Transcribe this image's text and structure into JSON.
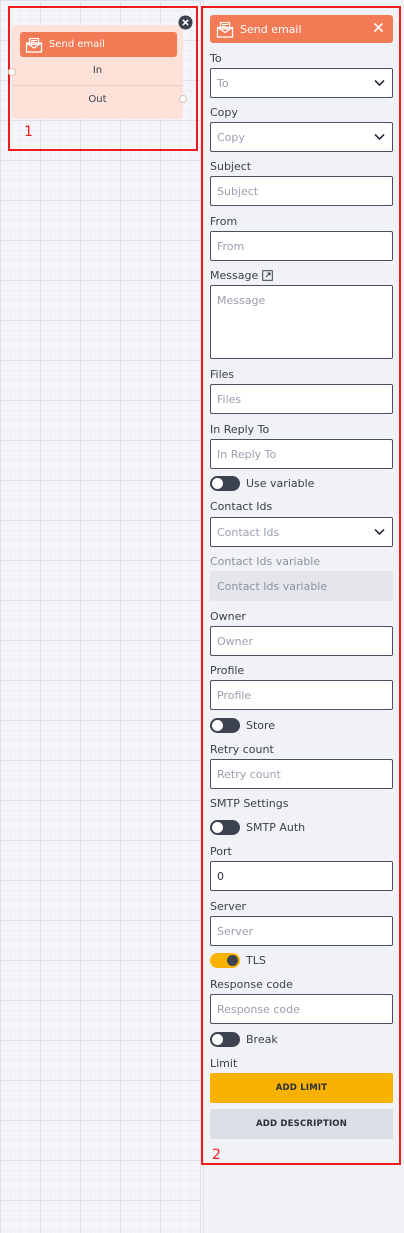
{
  "node": {
    "title": "Send email",
    "in_label": "In",
    "out_label": "Out",
    "region_label": "1"
  },
  "panel": {
    "title": "Send email",
    "region_label": "2",
    "to": {
      "label": "To",
      "placeholder": "To"
    },
    "copy": {
      "label": "Copy",
      "placeholder": "Copy"
    },
    "subject": {
      "label": "Subject",
      "placeholder": "Subject"
    },
    "from": {
      "label": "From",
      "placeholder": "From"
    },
    "message": {
      "label": "Message",
      "placeholder": "Message"
    },
    "files": {
      "label": "Files",
      "placeholder": "Files"
    },
    "in_reply_to": {
      "label": "In Reply To",
      "placeholder": "In Reply To"
    },
    "use_variable": {
      "label": "Use variable",
      "on": false
    },
    "contact_ids": {
      "label": "Contact Ids",
      "placeholder": "Contact Ids"
    },
    "contact_ids_variable": {
      "label": "Contact Ids variable",
      "placeholder": "Contact Ids variable"
    },
    "owner": {
      "label": "Owner",
      "placeholder": "Owner"
    },
    "profile": {
      "label": "Profile",
      "placeholder": "Profile"
    },
    "store": {
      "label": "Store",
      "on": false
    },
    "retry_count": {
      "label": "Retry count",
      "placeholder": "Retry count"
    },
    "smtp_settings_label": "SMTP Settings",
    "smtp_auth": {
      "label": "SMTP Auth",
      "on": false
    },
    "port": {
      "label": "Port",
      "value": "0"
    },
    "server": {
      "label": "Server",
      "placeholder": "Server"
    },
    "tls": {
      "label": "TLS",
      "on": true
    },
    "response_code": {
      "label": "Response code",
      "placeholder": "Response code"
    },
    "break": {
      "label": "Break",
      "on": false
    },
    "limit_label": "Limit",
    "add_limit_button": "ADD LIMIT",
    "add_description_button": "ADD DESCRIPTION"
  },
  "colors": {
    "accent": "#f27a55",
    "node_body": "#fde2da",
    "toggle_on": "#f9b100",
    "annotation_red": "#ee1c1c"
  },
  "icons": {
    "node_icon": "email-icon",
    "close_node": "close-circle-icon",
    "close_panel": "close-icon",
    "dropdown": "chevron-down-icon",
    "expand": "expand-icon"
  }
}
